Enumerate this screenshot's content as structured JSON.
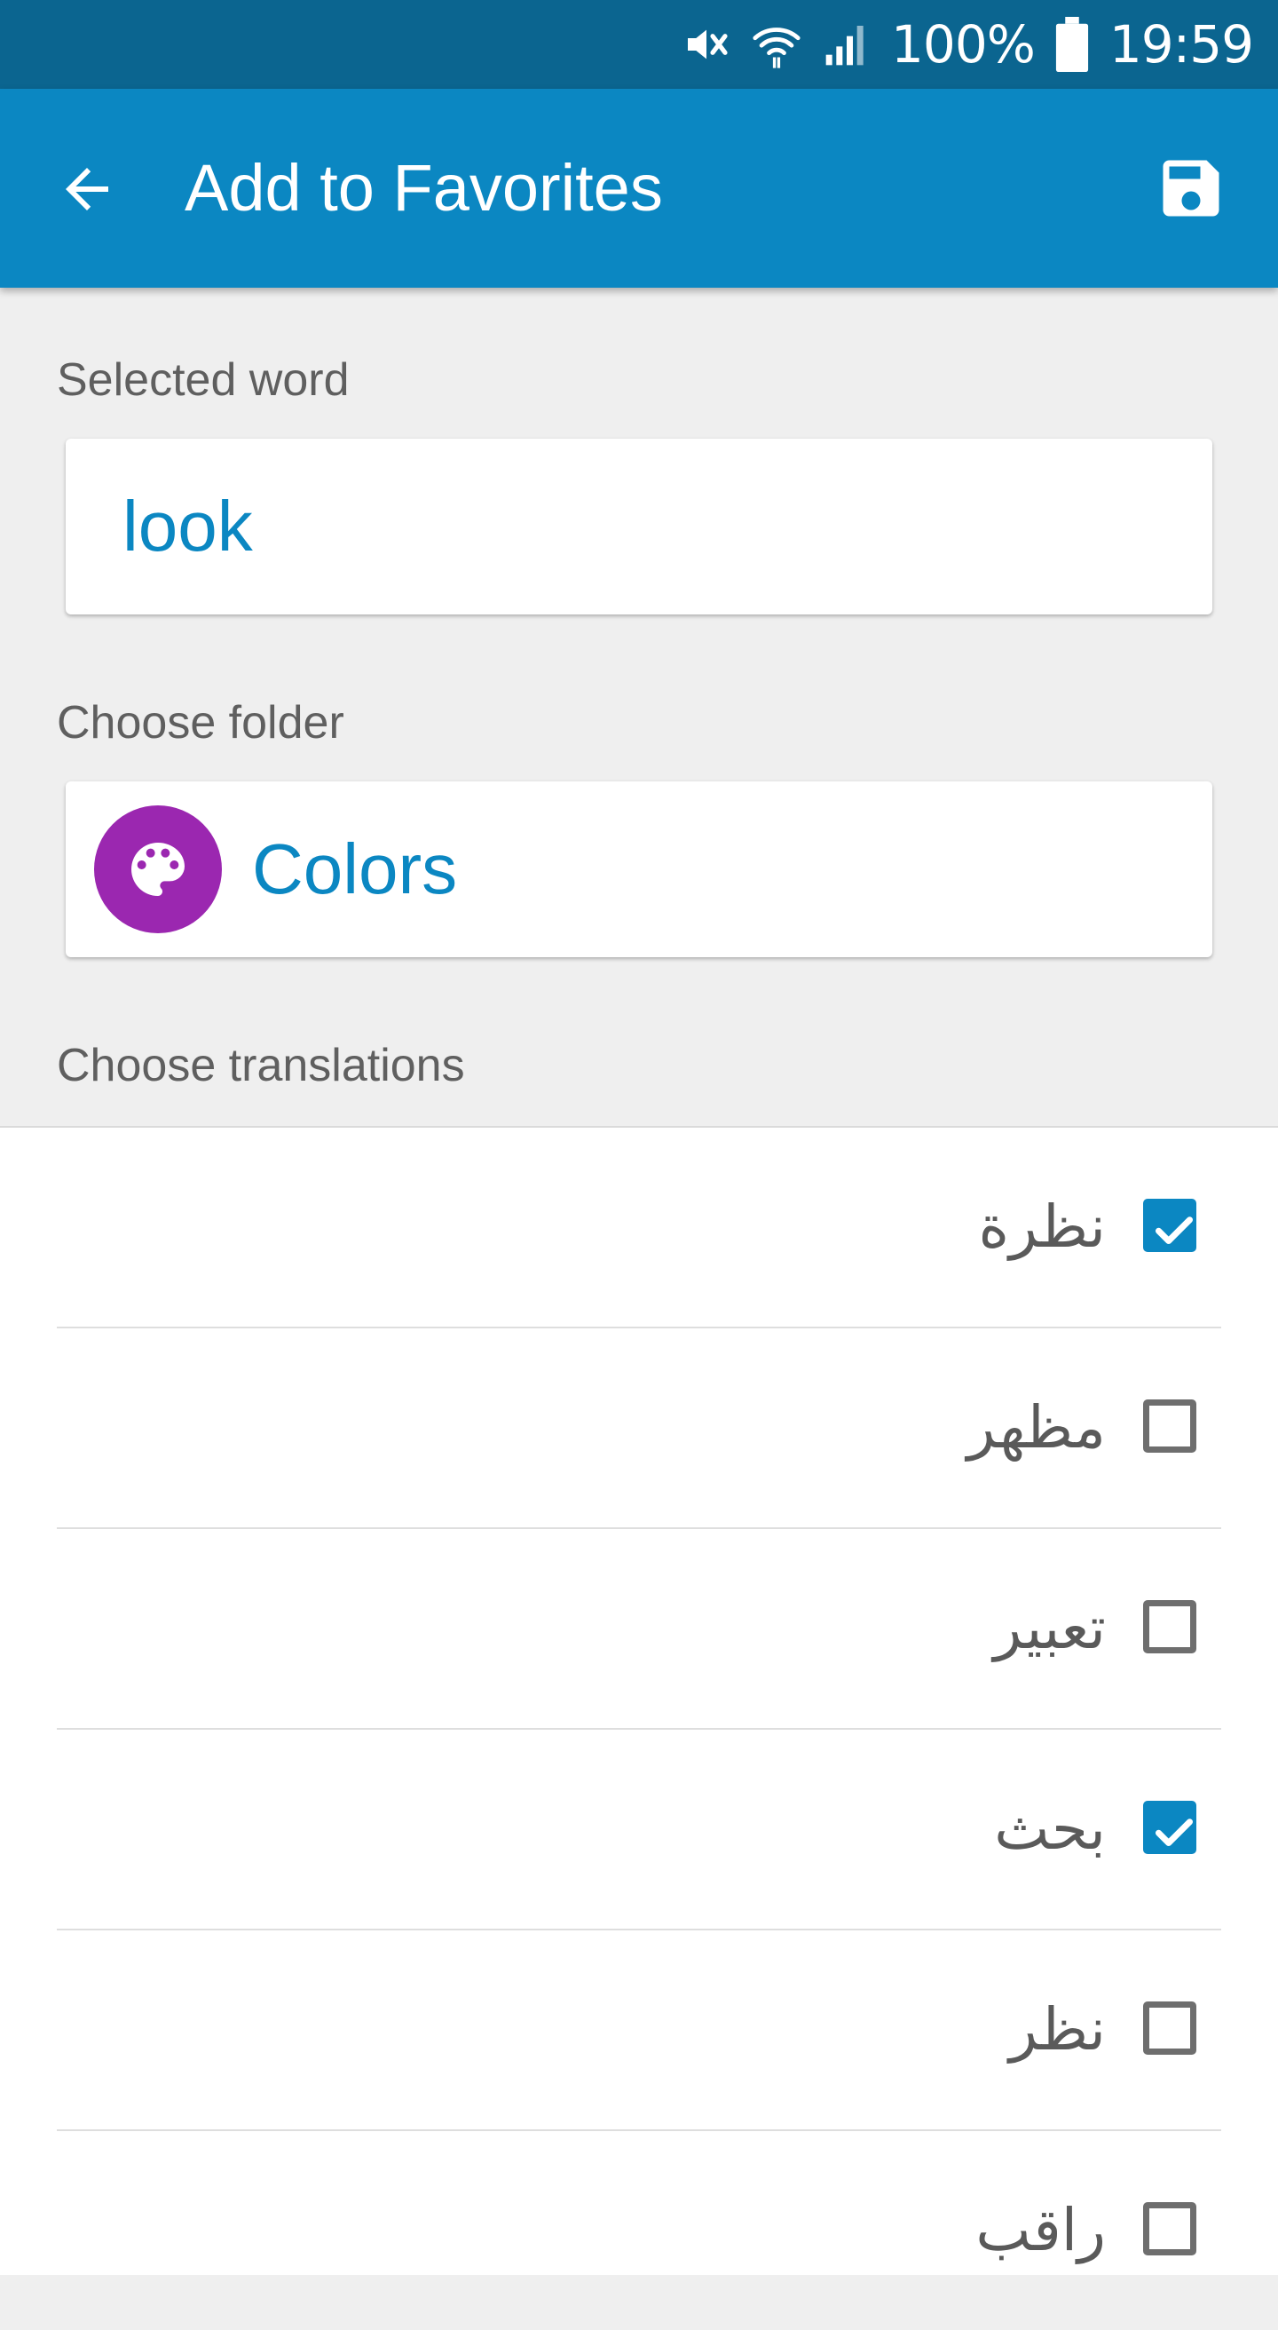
{
  "status_bar": {
    "battery": "100%",
    "time": "19:59",
    "icons": [
      "mute-icon",
      "wifi-icon",
      "signal-icon",
      "battery-icon"
    ]
  },
  "app_bar": {
    "title": "Add to Favorites",
    "icons": [
      "arrow-back-icon",
      "save-icon"
    ]
  },
  "form": {
    "selected_word_label": "Selected word",
    "selected_word_value": "look",
    "choose_folder_label": "Choose folder",
    "folder_name": "Colors",
    "folder_icon": "palette-icon",
    "folder_color": "#9b27b0",
    "choose_translations_label": "Choose translations"
  },
  "translations": [
    {
      "text": "نظرة",
      "checked": true
    },
    {
      "text": "مظهر",
      "checked": false
    },
    {
      "text": "تعبير",
      "checked": false
    },
    {
      "text": "بحث",
      "checked": true
    },
    {
      "text": "نظر",
      "checked": false
    },
    {
      "text": "راقب",
      "checked": false
    }
  ],
  "colors": {
    "accent": "#0b87c2",
    "status_bar": "#0b6590",
    "background": "#efefef"
  }
}
